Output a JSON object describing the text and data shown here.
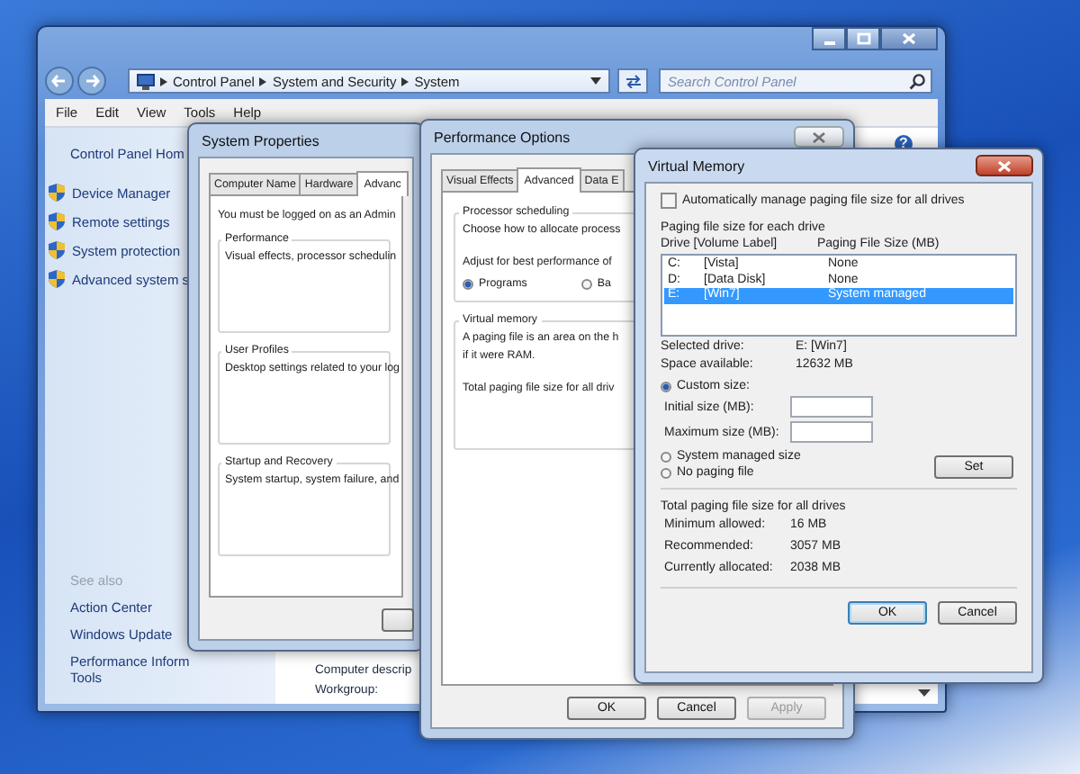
{
  "explorer": {
    "breadcrumb": [
      "Control Panel",
      "System and Security",
      "System"
    ],
    "search": {
      "placeholder": "Search Control Panel"
    },
    "menu": [
      "File",
      "Edit",
      "View",
      "Tools",
      "Help"
    ],
    "sidebar": {
      "home": "Control Panel Hom",
      "tasks": [
        "Device Manager",
        "Remote settings",
        "System protection",
        "Advanced system s"
      ],
      "see_also_heading": "See also",
      "see_also": [
        {
          "lines": [
            "Action Center"
          ]
        },
        {
          "lines": [
            "Windows Update"
          ]
        },
        {
          "lines": [
            "Performance Inform",
            "Tools"
          ]
        }
      ]
    },
    "details": [
      "Computer descrip",
      "Workgroup:"
    ],
    "help_glyph": "?"
  },
  "system_properties": {
    "title": "System Properties",
    "tabs": [
      {
        "label": "Computer Name",
        "selected": false
      },
      {
        "label": "Hardware",
        "selected": false
      },
      {
        "label": "Advanc",
        "selected": true
      }
    ],
    "notice": "You must be logged on as an Admin",
    "groups": [
      {
        "title": "Performance",
        "text": "Visual effects, processor schedulin"
      },
      {
        "title": "User Profiles",
        "text": "Desktop settings related to your log"
      },
      {
        "title": "Startup and Recovery",
        "text": "System startup, system failure, and"
      }
    ]
  },
  "performance_options": {
    "title": "Performance Options",
    "tabs": [
      {
        "label": "Visual Effects",
        "selected": false
      },
      {
        "label": "Advanced",
        "selected": true
      },
      {
        "label": "Data E",
        "selected": false
      }
    ],
    "processor_scheduling": {
      "title": "Processor scheduling",
      "text": "Choose how to allocate process",
      "adjust": "Adjust for best performance of",
      "options": [
        {
          "label": "Programs",
          "selected": true
        },
        {
          "label": "Ba",
          "selected": false
        }
      ]
    },
    "virtual_memory": {
      "title": "Virtual memory",
      "lines": [
        "A paging file is an area on the h",
        "if it were RAM.",
        "Total paging file size for all driv"
      ]
    },
    "buttons": [
      {
        "label": "OK",
        "disabled": false
      },
      {
        "label": "Cancel",
        "disabled": false
      },
      {
        "label": "Apply",
        "disabled": true
      }
    ]
  },
  "virtual_memory": {
    "title": "Virtual Memory",
    "auto_manage": {
      "label": "Automatically manage paging file size for all drives",
      "checked": false
    },
    "section": "Paging file size for each drive",
    "columns": [
      "Drive  [Volume Label]",
      "Paging File Size (MB)"
    ],
    "drives": [
      {
        "drive": "C:",
        "label": "[Vista]",
        "size": "None",
        "selected": false
      },
      {
        "drive": "D:",
        "label": "[Data Disk]",
        "size": "None",
        "selected": false
      },
      {
        "drive": "E:",
        "label": "[Win7]",
        "size": "System managed",
        "selected": true
      }
    ],
    "info": [
      {
        "label": "Selected drive:",
        "value": "E:  [Win7]"
      },
      {
        "label": "Space available:",
        "value": "12632 MB"
      }
    ],
    "custom": {
      "label": "Custom size:",
      "selected": true
    },
    "fields": [
      {
        "label": "Initial size (MB):"
      },
      {
        "label": "Maximum size (MB):"
      }
    ],
    "options": [
      {
        "label": "System managed size",
        "selected": false
      },
      {
        "label": "No paging file",
        "selected": false
      }
    ],
    "set_button": "Set",
    "totals_heading": "Total paging file size for all drives",
    "totals": [
      {
        "label": "Minimum allowed:",
        "value": "16 MB"
      },
      {
        "label": "Recommended:",
        "value": "3057 MB"
      },
      {
        "label": "Currently allocated:",
        "value": "2038 MB"
      }
    ],
    "buttons": [
      "OK",
      "Cancel"
    ]
  }
}
